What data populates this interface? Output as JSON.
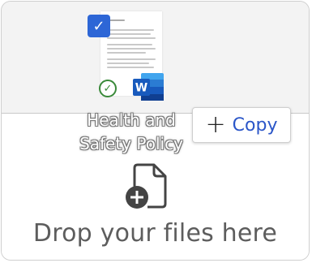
{
  "drop_zone": {
    "message": "Drop your files here"
  },
  "drag_preview": {
    "file_name_line1": "Health and",
    "file_name_line2": "Safety Policy",
    "file_type_icon": "word-icon",
    "word_letter": "W",
    "selected": true
  },
  "drop_action": {
    "plus_glyph": "+",
    "label": "Copy"
  },
  "colors": {
    "accent_blue": "#2d66d6",
    "copy_text": "#2b56c8",
    "word_blue": "#185abd",
    "success_green": "#3a8a3a",
    "message_gray": "#5d5d5d"
  }
}
